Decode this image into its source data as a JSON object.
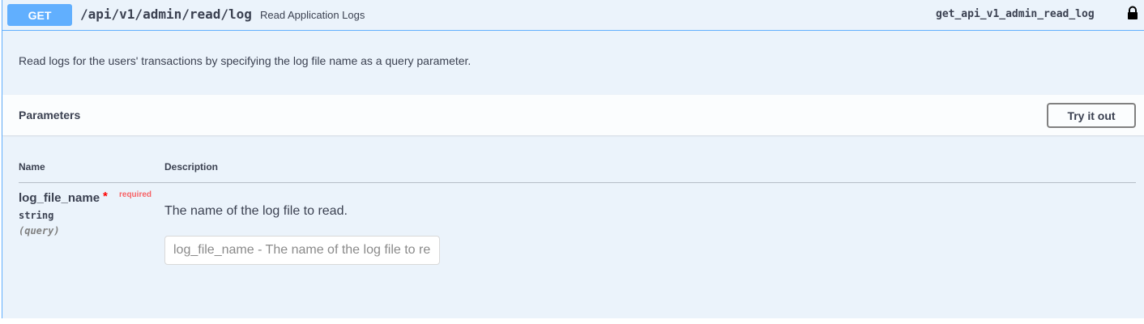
{
  "operation": {
    "method": "GET",
    "path": "/api/v1/admin/read/log",
    "summary": "Read Application Logs",
    "operation_id": "get_api_v1_admin_read_log",
    "description": "Read logs for the users' transactions by specifying the log file name as a query parameter.",
    "lock_icon": "lock-icon",
    "colors": {
      "method_bg": "#61affe",
      "block_bg": "#ebf3fb",
      "required": "#ff0000"
    }
  },
  "parameters": {
    "title": "Parameters",
    "try_label": "Try it out",
    "columns": {
      "name": "Name",
      "description": "Description"
    },
    "items": [
      {
        "name": "log_file_name",
        "required_mark": "*",
        "required_label": "required",
        "type": "string",
        "in": "(query)",
        "description": "The name of the log file to read.",
        "placeholder": "log_file_name - The name of the log file to read"
      }
    ]
  }
}
